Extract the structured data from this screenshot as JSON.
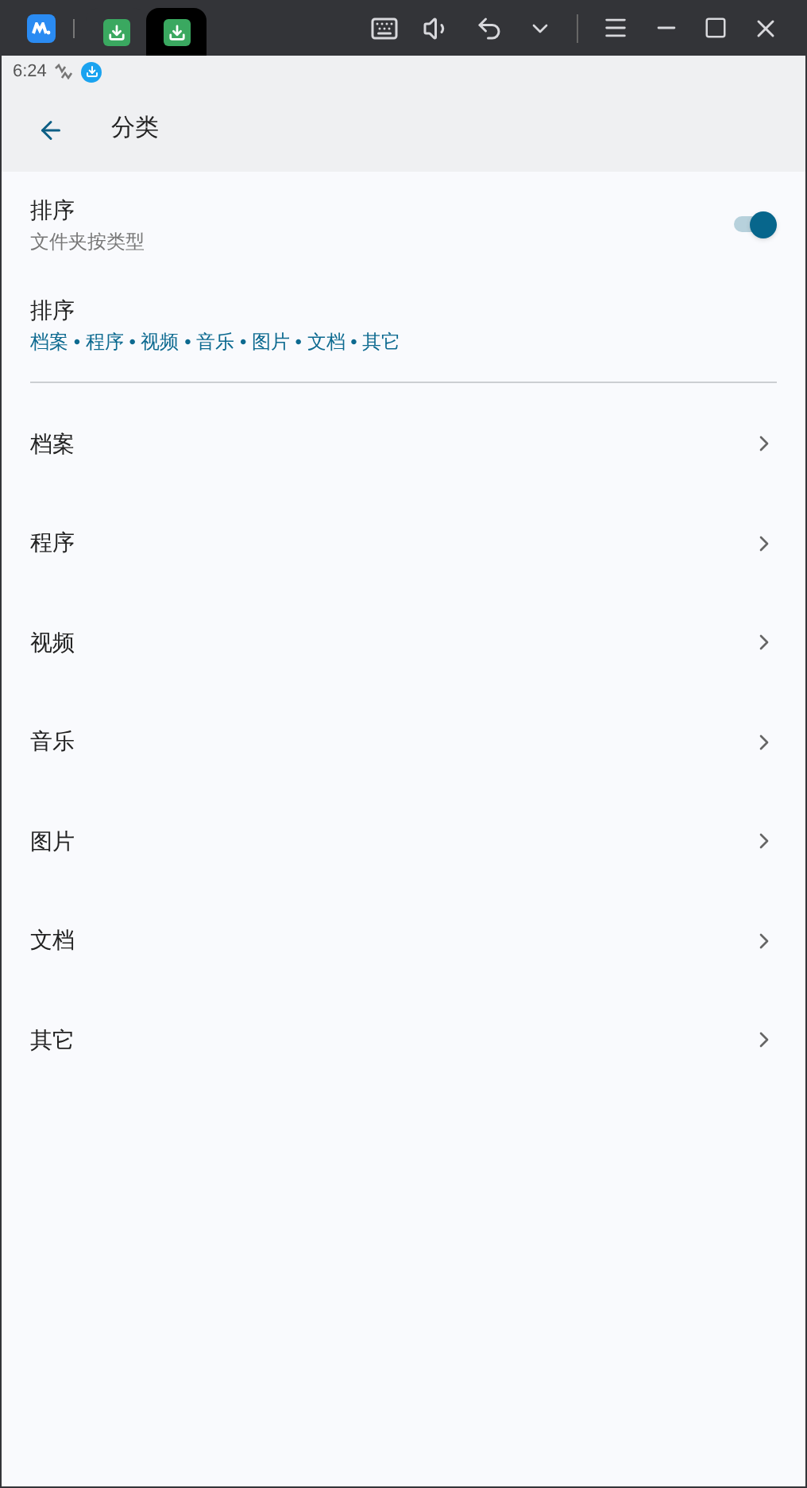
{
  "window_tabs": [
    {
      "selected": false
    },
    {
      "selected": true
    }
  ],
  "status_bar": {
    "time": "6:24"
  },
  "header": {
    "title": "分类"
  },
  "settings": [
    {
      "kind": "toggle",
      "title": "排序",
      "subtitle": "文件夹按类型",
      "on": true
    },
    {
      "kind": "text",
      "title": "排序",
      "subtitle": "档案 • 程序 • 视频 • 音乐 • 图片 • 文档 • 其它"
    }
  ],
  "categories": [
    "档案",
    "程序",
    "视频",
    "音乐",
    "图片",
    "文档",
    "其它"
  ]
}
